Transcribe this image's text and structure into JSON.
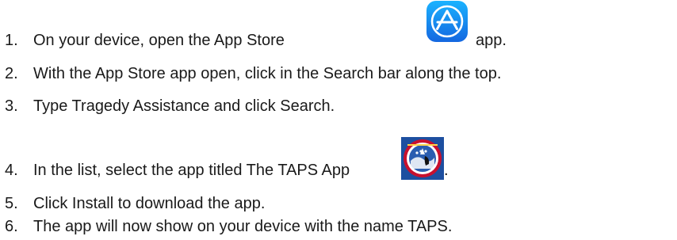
{
  "steps": [
    {
      "num": "1.",
      "before": "On your device, open the App Store",
      "after": "app."
    },
    {
      "num": "2.",
      "text": "With the App Store app open, click in the Search bar along the top."
    },
    {
      "num": "3.",
      "text": "Type Tragedy Assistance and click Search."
    },
    {
      "num": "4.",
      "before": "In the list, select the app titled The TAPS App",
      "after": "."
    },
    {
      "num": "5.",
      "text": "Click Install to download the app."
    },
    {
      "num": "6.",
      "text": "The app will now show on your device with the name TAPS."
    }
  ],
  "icons": {
    "appstore": "app-store-icon",
    "taps": "taps-app-icon"
  },
  "colors": {
    "appstore_blue_top": "#1bb3ff",
    "appstore_blue_bottom": "#1467e0",
    "taps_blue": "#1d4fa0",
    "taps_red": "#c8102e"
  }
}
